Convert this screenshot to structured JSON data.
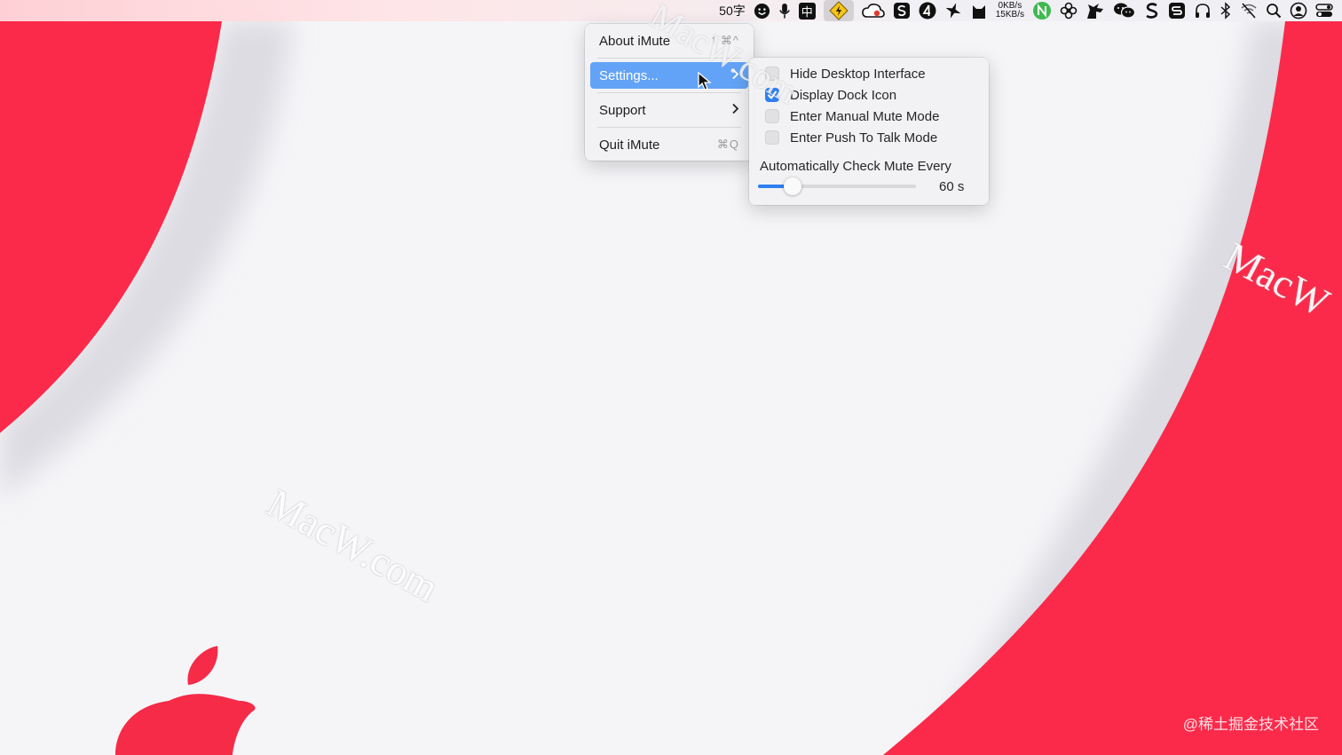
{
  "menubar": {
    "word_count": "50字",
    "ime_label": "中",
    "net_up": "0KB/s",
    "net_down": "15KB/s",
    "icons": [
      "smile-icon",
      "microphone-icon",
      "ime-icon",
      "imute-icon",
      "cloud-icon",
      "app-s-icon",
      "app-a-icon",
      "spark-icon",
      "cat-icon",
      "netspeed",
      "n-badge-icon",
      "flower-icon",
      "unicorn-icon",
      "wechat-icon",
      "s-logo-icon",
      "s-box-icon",
      "headphones-icon",
      "bluetooth-icon",
      "wifi-off-icon",
      "search-icon",
      "user-icon",
      "control-center-icon"
    ]
  },
  "main_menu": {
    "items": [
      {
        "label": "About iMute",
        "shortcut": "⇧⌘^"
      },
      {
        "label": "Settings...",
        "shortcut": "",
        "submenu": true,
        "selected": true
      },
      {
        "label": "Support",
        "shortcut": "",
        "submenu": true
      },
      {
        "label": "Quit iMute",
        "shortcut": "⌘Q"
      }
    ]
  },
  "settings_menu": {
    "options": [
      {
        "label": "Hide Desktop Interface",
        "checked": false
      },
      {
        "label": "Display Dock Icon",
        "checked": true
      },
      {
        "label": "Enter Manual Mute Mode",
        "checked": false
      },
      {
        "label": "Enter Push To Talk Mode",
        "checked": false
      }
    ],
    "slider_label": "Automatically Check Mute Every",
    "slider_value_text": "60 s",
    "slider_fraction": 0.22
  },
  "watermarks": {
    "center": "MacW.com",
    "right": "MacW",
    "menu": "MacW.com"
  },
  "credit": "@稀土掘金技术社区",
  "colors": {
    "wallpaper_red": "#fb2a4a",
    "selection_blue": "#63a3f7",
    "accent_blue": "#2f7ff0"
  }
}
